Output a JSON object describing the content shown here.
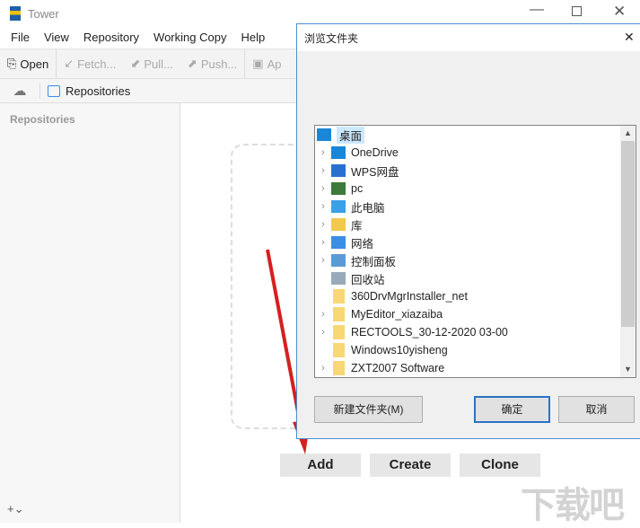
{
  "app": {
    "title": "Tower",
    "menu": [
      "File",
      "View",
      "Repository",
      "Working Copy",
      "Help"
    ],
    "toolbar": {
      "open": "Open",
      "fetch": "Fetch...",
      "pull": "Pull...",
      "push": "Push...",
      "apply": "Ap"
    },
    "tab_repositories": "Repositories",
    "sidebar_heading": "Repositories",
    "buttons": {
      "add": "Add",
      "create": "Create",
      "clone": "Clone"
    }
  },
  "dialog": {
    "title": "浏览文件夹",
    "root": "桌面",
    "items": [
      {
        "label": "OneDrive",
        "expandable": true,
        "icon": "cloud-icon"
      },
      {
        "label": "WPS网盘",
        "expandable": true,
        "icon": "wps-cloud-icon"
      },
      {
        "label": "pc",
        "expandable": true,
        "icon": "user-icon"
      },
      {
        "label": "此电脑",
        "expandable": true,
        "icon": "computer-icon"
      },
      {
        "label": "库",
        "expandable": true,
        "icon": "library-icon"
      },
      {
        "label": "网络",
        "expandable": true,
        "icon": "network-icon"
      },
      {
        "label": "控制面板",
        "expandable": true,
        "icon": "control-panel-icon"
      },
      {
        "label": "回收站",
        "expandable": false,
        "icon": "recycle-bin-icon"
      },
      {
        "label": "360DrvMgrInstaller_net",
        "expandable": false,
        "icon": "folder-icon"
      },
      {
        "label": "MyEditor_xiazaiba",
        "expandable": true,
        "icon": "folder-icon"
      },
      {
        "label": "RECTOOLS_30-12-2020 03-00",
        "expandable": true,
        "icon": "folder-icon"
      },
      {
        "label": "Windows10yisheng",
        "expandable": false,
        "icon": "folder-icon"
      },
      {
        "label": "ZXT2007 Software",
        "expandable": true,
        "icon": "folder-icon"
      }
    ],
    "new_folder": "新建文件夹(M)",
    "ok": "确定",
    "cancel": "取消"
  },
  "watermark": "下载吧 www.xiazaiba.com"
}
